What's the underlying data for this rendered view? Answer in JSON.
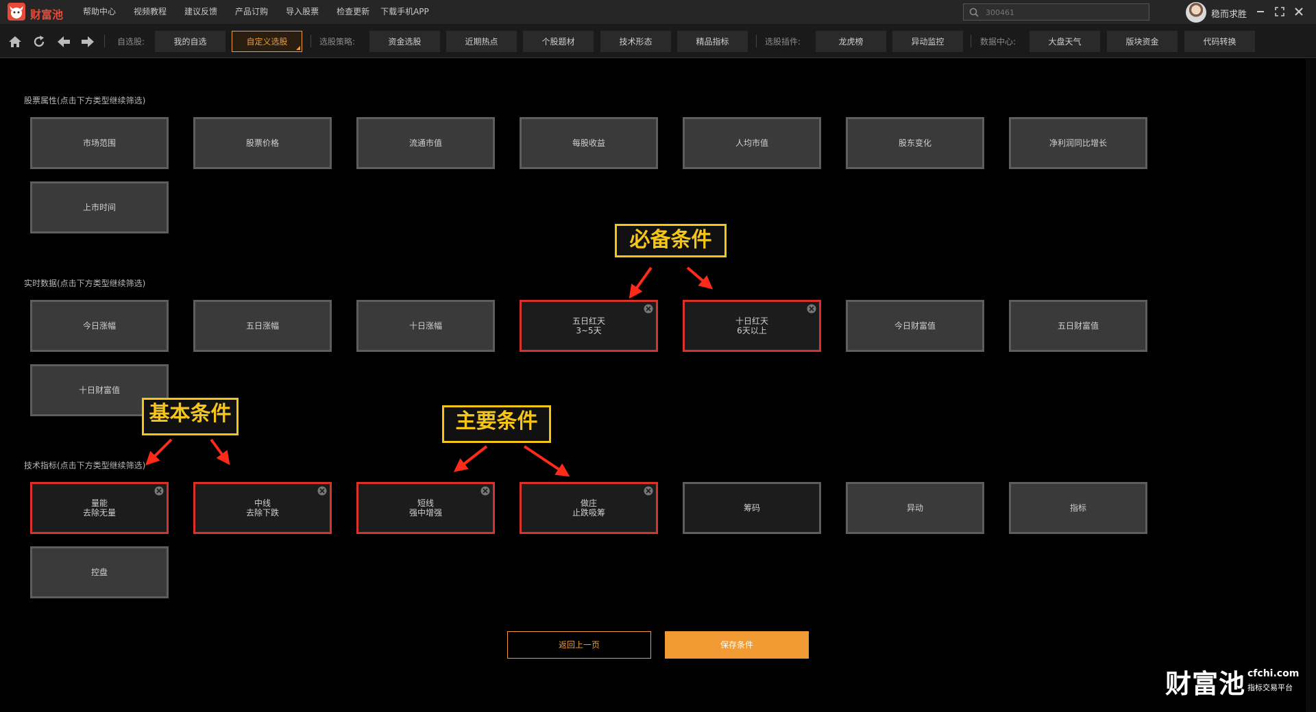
{
  "app": {
    "title": "财富池",
    "menu": [
      "帮助中心",
      "视频教程",
      "建议反馈",
      "产品订购",
      "导入股票",
      "检查更新",
      "下载手机APP"
    ],
    "search_placeholder": "300461",
    "username": "稳而求胜"
  },
  "toolbar": {
    "self_label": "自选股:",
    "self_items": [
      "我的自选",
      "自定义选股"
    ],
    "strategy_label": "选股策略:",
    "strategy_items": [
      "资金选股",
      "近期热点",
      "个股题材",
      "技术形态",
      "精品指标"
    ],
    "plugin_label": "选股插件:",
    "plugin_items": [
      "龙虎榜",
      "异动监控"
    ],
    "data_label": "数据中心:",
    "data_items": [
      "大盘天气",
      "版块资金",
      "代码转换"
    ],
    "active_item": "自定义选股"
  },
  "sections": {
    "stock": {
      "title": "股票属性(点击下方类型继续筛选)",
      "items": [
        {
          "line1": "市场范围",
          "line2": ""
        },
        {
          "line1": "股票价格",
          "line2": ""
        },
        {
          "line1": "流通市值",
          "line2": ""
        },
        {
          "line1": "每股收益",
          "line2": ""
        },
        {
          "line1": "人均市值",
          "line2": ""
        },
        {
          "line1": "股东变化",
          "line2": ""
        },
        {
          "line1": "净利润同比增长",
          "line2": ""
        },
        {
          "line1": "上市时间",
          "line2": ""
        }
      ]
    },
    "realtime": {
      "title": "实时数据(点击下方类型继续筛选)",
      "items": [
        {
          "line1": "今日涨幅",
          "line2": ""
        },
        {
          "line1": "五日涨幅",
          "line2": ""
        },
        {
          "line1": "十日涨幅",
          "line2": ""
        },
        {
          "line1": "五日红天",
          "line2": "3~5天"
        },
        {
          "line1": "十日红天",
          "line2": "6天以上"
        },
        {
          "line1": "今日财富值",
          "line2": ""
        },
        {
          "line1": "五日财富值",
          "line2": ""
        },
        {
          "line1": "十日财富值",
          "line2": ""
        }
      ]
    },
    "tech": {
      "title": "技术指标(点击下方类型继续筛选)",
      "items": [
        {
          "line1": "量能",
          "line2": "去除无量"
        },
        {
          "line1": "中线",
          "line2": "去除下跌"
        },
        {
          "line1": "短线",
          "line2": "强中增强"
        },
        {
          "line1": "做庄",
          "line2": "止跌吸筹"
        },
        {
          "line1": "筹码",
          "line2": ""
        },
        {
          "line1": "异动",
          "line2": ""
        },
        {
          "line1": "指标",
          "line2": ""
        },
        {
          "line1": "控盘",
          "line2": ""
        }
      ]
    }
  },
  "annotations": {
    "required": "必备条件",
    "basic": "基本条件",
    "main": "主要条件"
  },
  "buttons": {
    "back": "返回上一页",
    "save": "保存条件"
  },
  "watermark": {
    "brand": "财富池",
    "url": "cfchi.com",
    "tagline": "指标交易平台"
  },
  "colors": {
    "accent": "#f29b34",
    "selected_border": "#d8322b",
    "annotation": "#f5c518"
  }
}
